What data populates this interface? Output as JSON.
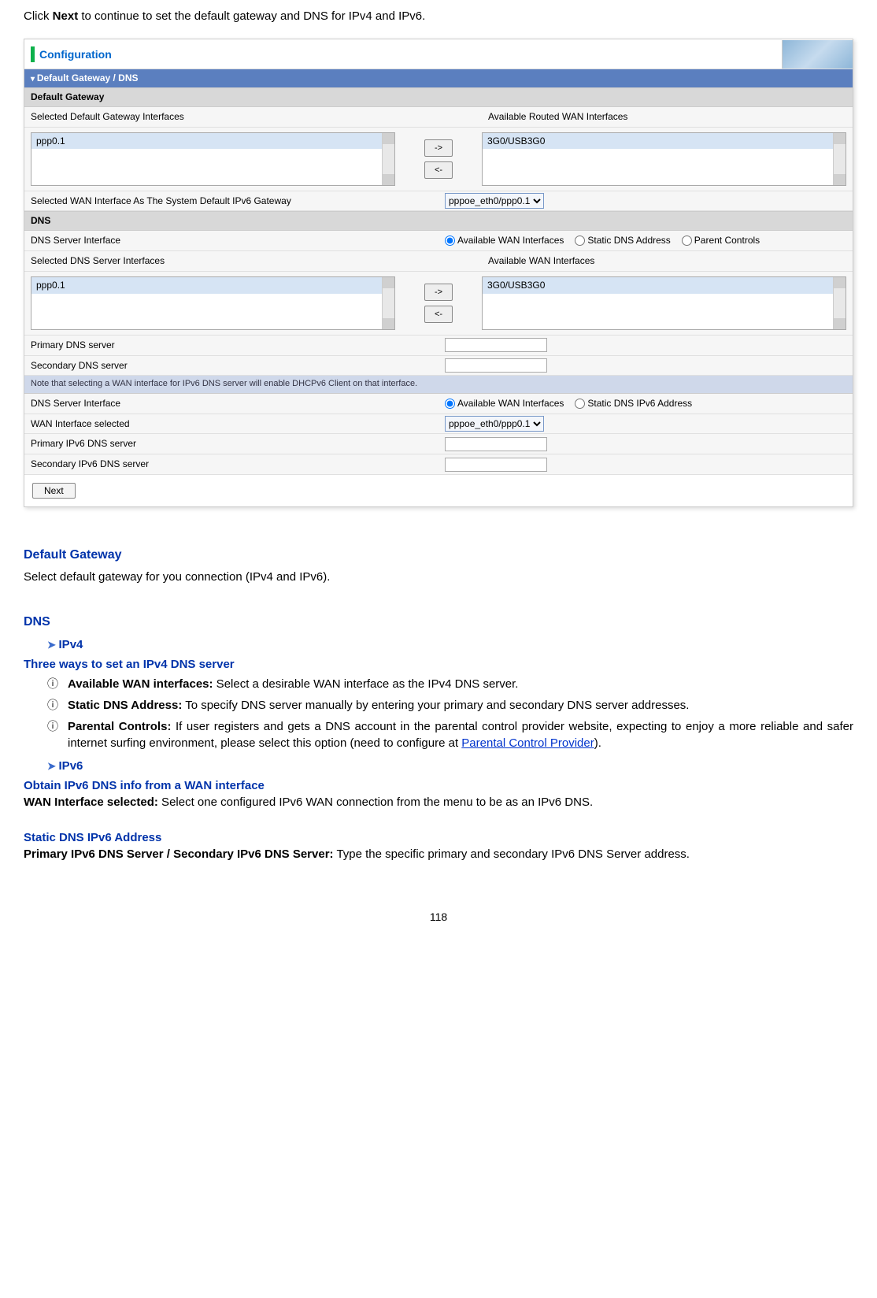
{
  "intro": {
    "prefix": "Click ",
    "bold": "Next",
    "suffix": " to continue to set the default gateway and DNS for IPv4 and IPv6."
  },
  "panel": {
    "title": "Configuration",
    "section_bar": "Default Gateway / DNS",
    "default_gateway_header": "Default Gateway",
    "sel_gw_label": "Selected Default Gateway Interfaces",
    "avail_wan_label": "Available Routed WAN Interfaces",
    "left_list_gw": "ppp0.1",
    "right_list_gw": "3G0/USB3G0",
    "move_right": "->",
    "move_left": "<-",
    "ipv6_gw_label": "Selected WAN Interface As The System Default IPv6 Gateway",
    "ipv6_gw_value": "pppoe_eth0/ppp0.1",
    "dns_header": "DNS",
    "dns_srv_iface_label": "DNS Server Interface",
    "radio_avail_wan": "Available WAN Interfaces",
    "radio_static_dns": "Static DNS Address",
    "radio_parent": "Parent Controls",
    "sel_dns_label": "Selected DNS Server Interfaces",
    "avail_wan_label2": "Available WAN Interfaces",
    "left_list_dns": "ppp0.1",
    "right_list_dns": "3G0/USB3G0",
    "primary_dns_label": "Primary DNS server",
    "secondary_dns_label": "Secondary DNS server",
    "ipv6_note": "Note that selecting a WAN interface for IPv6 DNS server will enable DHCPv6 Client on that interface.",
    "dns_srv_iface_label2": "DNS Server Interface",
    "radio_avail_wan2": "Available WAN Interfaces",
    "radio_static_ipv6": "Static DNS IPv6 Address",
    "wan_iface_sel_label": "WAN Interface selected",
    "wan_iface_sel_value": "pppoe_eth0/ppp0.1",
    "primary_ipv6_label": "Primary IPv6 DNS server",
    "secondary_ipv6_label": "Secondary IPv6 DNS server",
    "next_btn": "Next"
  },
  "doc": {
    "h_default_gw": "Default Gateway",
    "p_default_gw": "Select default gateway for you connection (IPv4 and IPv6).",
    "h_dns": "DNS",
    "chev_ipv4": "IPv4",
    "h_ipv4_ways": "Three ways to set an IPv4 DNS server",
    "li1_b": "Available WAN interfaces:",
    "li1_t": " Select a desirable WAN interface as the IPv4 DNS server.",
    "li2_b": "Static DNS Address:",
    "li2_t": " To specify DNS server manually by entering your primary and secondary DNS server addresses.",
    "li3_b": "Parental Controls:",
    "li3_t_a": " If user registers and gets a DNS account in the parental control provider website, expecting to enjoy a more reliable and safer internet surfing environment, please select this option (need to configure at ",
    "li3_link": "Parental Control Provider",
    "li3_t_b": ").",
    "chev_ipv6": "IPv6",
    "h_ipv6_obtain": "Obtain IPv6 DNS info from a WAN interface",
    "p_wan_sel_b": "WAN Interface selected:",
    "p_wan_sel_t": " Select one configured IPv6 WAN connection from the menu to be as an IPv6 DNS.",
    "h_static_ipv6": "Static DNS IPv6 Address",
    "p_ipv6_b": "Primary IPv6 DNS Server / Secondary IPv6 DNS Server:",
    "p_ipv6_t": " Type the specific primary and secondary IPv6 DNS Server address.",
    "pagenum": "118"
  }
}
